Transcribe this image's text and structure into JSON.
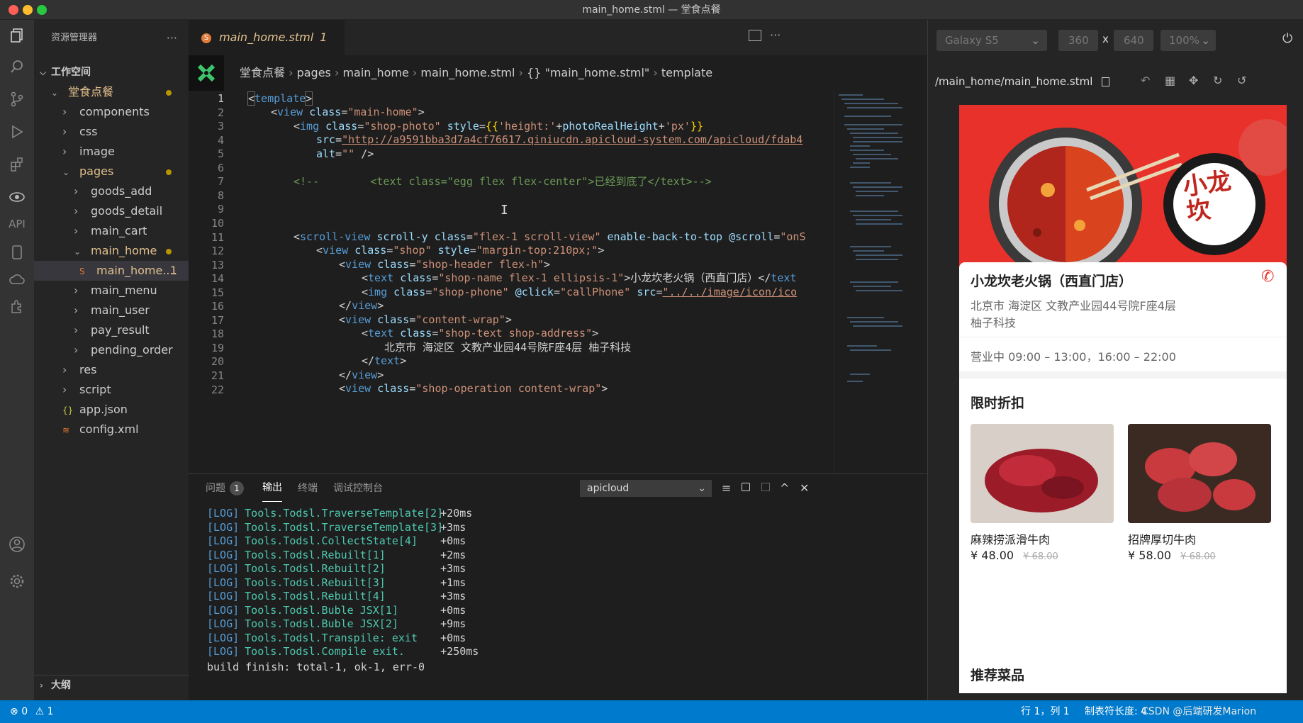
{
  "window": {
    "title": "main_home.stml — 堂食点餐"
  },
  "activity_bar": {
    "api_label": "API"
  },
  "sidebar": {
    "header": "资源管理器",
    "workspace": "工作空间",
    "items": [
      {
        "label": "堂食点餐",
        "type": "folder-open",
        "modified": true
      },
      {
        "label": "components",
        "type": "folder"
      },
      {
        "label": "css",
        "type": "folder"
      },
      {
        "label": "image",
        "type": "folder"
      },
      {
        "label": "pages",
        "type": "folder-open",
        "modified": true
      },
      {
        "label": "goods_add",
        "type": "folder"
      },
      {
        "label": "goods_detail",
        "type": "folder"
      },
      {
        "label": "main_cart",
        "type": "folder"
      },
      {
        "label": "main_home",
        "type": "folder-open",
        "modified": true
      },
      {
        "label": "main_home....",
        "type": "file-active",
        "badge": "1"
      },
      {
        "label": "main_menu",
        "type": "folder"
      },
      {
        "label": "main_user",
        "type": "folder"
      },
      {
        "label": "pay_result",
        "type": "folder"
      },
      {
        "label": "pending_order",
        "type": "folder"
      },
      {
        "label": "res",
        "type": "folder"
      },
      {
        "label": "script",
        "type": "folder"
      },
      {
        "label": "app.json",
        "type": "json"
      },
      {
        "label": "config.xml",
        "type": "xml"
      }
    ],
    "outline": "大纲"
  },
  "editor": {
    "tab": {
      "label": "main_home.stml",
      "badge": "1"
    },
    "breadcrumb": [
      "堂食点餐",
      "pages",
      "main_home",
      "main_home.stml",
      "{} \"main_home.stml\"",
      "template"
    ],
    "line_numbers": [
      "1",
      "2",
      "3",
      "4",
      "5",
      "6",
      "7",
      "8",
      "9",
      "10",
      "11",
      "12",
      "13",
      "14",
      "15",
      "16",
      "17",
      "18",
      "19",
      "20",
      "21",
      "22"
    ]
  },
  "panel": {
    "tabs": [
      "问题",
      "输出",
      "终端",
      "调试控制台"
    ],
    "problem_count": "1",
    "channel": "apicloud",
    "log": [
      {
        "tag": "[LOG]",
        "name": "Tools.Todsl.TraverseTemplate[2]",
        "time": "+20ms"
      },
      {
        "tag": "[LOG]",
        "name": "Tools.Todsl.TraverseTemplate[3]",
        "time": "+3ms"
      },
      {
        "tag": "[LOG]",
        "name": "Tools.Todsl.CollectState[4]",
        "time": "+0ms"
      },
      {
        "tag": "[LOG]",
        "name": "Tools.Todsl.Rebuilt[1]",
        "time": "+2ms"
      },
      {
        "tag": "[LOG]",
        "name": "Tools.Todsl.Rebuilt[2]",
        "time": "+3ms"
      },
      {
        "tag": "[LOG]",
        "name": "Tools.Todsl.Rebuilt[3]",
        "time": "+1ms"
      },
      {
        "tag": "[LOG]",
        "name": "Tools.Todsl.Rebuilt[4]",
        "time": "+3ms"
      },
      {
        "tag": "[LOG]",
        "name": "Tools.Todsl.Buble JSX[1]",
        "time": "+0ms"
      },
      {
        "tag": "[LOG]",
        "name": "Tools.Todsl.Buble JSX[2]",
        "time": "+9ms"
      },
      {
        "tag": "[LOG]",
        "name": "Tools.Todsl.Transpile: exit",
        "time": "+0ms"
      },
      {
        "tag": "[LOG]",
        "name": "Tools.Todsl.Compile exit.",
        "time": "+250ms"
      }
    ],
    "final": "build finish: total-1, ok-1, err-0"
  },
  "preview": {
    "device": "Galaxy S5",
    "width": "360",
    "x": "x",
    "height": "640",
    "zoom": "100%",
    "path": "/main_home/main_home.stml",
    "banner_text": "小龙坎",
    "shop_name": "小龙坎老火锅（西直门店）",
    "address": "北京市 海淀区 文教产业园44号院F座4层 柚子科技",
    "hours": "营业中 09:00 – 13:00，16:00 – 22:00",
    "discount_title": "限时折扣",
    "items": [
      {
        "name": "麻辣捞派滑牛肉",
        "price": "¥ 48.00",
        "old_price": "¥ 68.00"
      },
      {
        "name": "招牌厚切牛肉",
        "price": "¥ 58.00",
        "old_price": "¥ 68.00"
      }
    ],
    "recommend_title": "推荐菜品"
  },
  "status": {
    "errors": "0",
    "warnings": "1",
    "position": "行 1，列 1",
    "indent": "制表符长度: 4",
    "watermark": "CSDN @后端研发Marion"
  },
  "colors": {
    "accent": "#007acc",
    "banner": "#e8312a",
    "phone_icon": "#e8312a"
  }
}
